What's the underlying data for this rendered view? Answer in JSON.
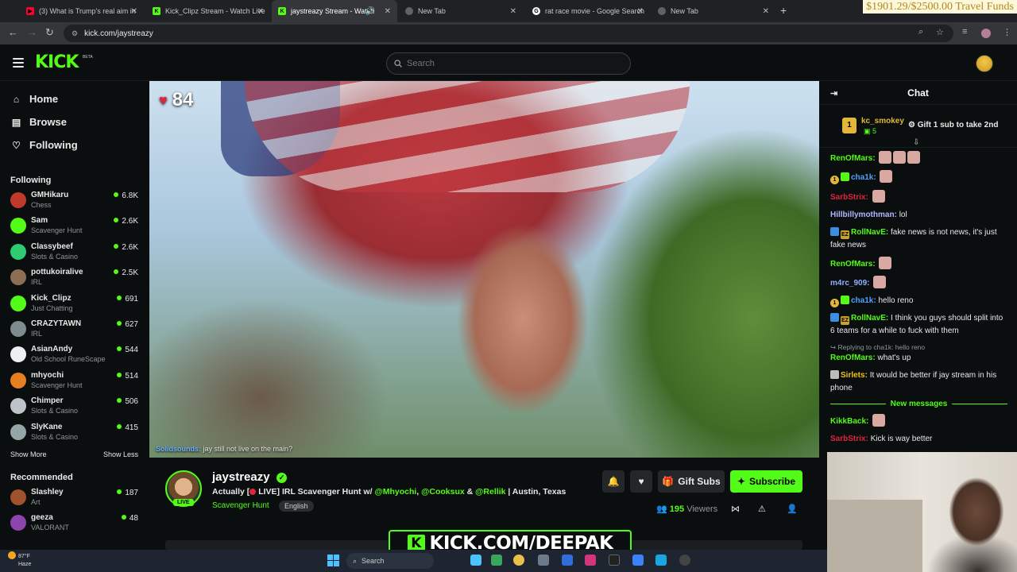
{
  "browser": {
    "tabs": [
      {
        "title": "(3) What is Trump's real aim in",
        "active": false,
        "favicon": "youtube-icon",
        "color": "#ff0033"
      },
      {
        "title": "Kick_Clipz Stream - Watch Live",
        "active": false,
        "favicon": "kick-icon",
        "color": "#53fc18"
      },
      {
        "title": "jaystreazy Stream - Watch",
        "active": true,
        "favicon": "kick-icon",
        "color": "#53fc18"
      },
      {
        "title": "New Tab",
        "active": false,
        "favicon": "globe-icon",
        "color": "#9aa0a6"
      },
      {
        "title": "rat race movie - Google Search",
        "active": false,
        "favicon": "google-icon",
        "color": "#ffffff"
      },
      {
        "title": "New Tab",
        "active": false,
        "favicon": "globe-icon",
        "color": "#9aa0a6"
      }
    ],
    "url": "kick.com/jaystreazy",
    "overlay_text": "$1901.29/$2500.00 Travel Funds"
  },
  "kick": {
    "logo": "KICK",
    "logo_badge": "BETA",
    "search_placeholder": "Search",
    "accent": "#53fc18"
  },
  "sidebar": {
    "nav": [
      {
        "label": "Home",
        "icon": "home-icon"
      },
      {
        "label": "Browse",
        "icon": "browse-icon"
      },
      {
        "label": "Following",
        "icon": "heart-icon"
      }
    ],
    "following_title": "Following",
    "following": [
      {
        "name": "GMHikaru",
        "category": "Chess",
        "viewers": "6.8K",
        "color": "#c0392b"
      },
      {
        "name": "Sam",
        "category": "Scavenger Hunt",
        "viewers": "2.6K",
        "color": "#53fc18"
      },
      {
        "name": "Classybeef",
        "category": "Slots & Casino",
        "viewers": "2.6K",
        "color": "#2ecc71"
      },
      {
        "name": "pottukoiralive",
        "category": "IRL",
        "viewers": "2.5K",
        "color": "#8e6e53"
      },
      {
        "name": "Kick_Clipz",
        "category": "Just Chatting",
        "viewers": "691",
        "color": "#53fc18"
      },
      {
        "name": "CRAZYTAWN",
        "category": "IRL",
        "viewers": "627",
        "color": "#7f8c8d"
      },
      {
        "name": "AsianAndy",
        "category": "Old School RuneScape",
        "viewers": "544",
        "color": "#ecf0f1"
      },
      {
        "name": "mhyochi",
        "category": "Scavenger Hunt",
        "viewers": "514",
        "color": "#e67e22"
      },
      {
        "name": "Chimper",
        "category": "Slots & Casino",
        "viewers": "506",
        "color": "#bdc3c7"
      },
      {
        "name": "SlyKane",
        "category": "Slots & Casino",
        "viewers": "415",
        "color": "#95a5a6"
      }
    ],
    "show_more": "Show More",
    "show_less": "Show Less",
    "recommended_title": "Recommended",
    "recommended": [
      {
        "name": "Slashley",
        "category": "Art",
        "viewers": "187",
        "color": "#a0522d"
      },
      {
        "name": "geeza",
        "category": "VALORANT",
        "viewers": "48",
        "color": "#8e44ad"
      }
    ]
  },
  "video": {
    "viewer_count": "84",
    "overlay_user": "Solidsounds:",
    "overlay_msg": "jay still not live on the main?"
  },
  "stream": {
    "streamer": "jaystreazy",
    "live_label": "LIVE",
    "title_prefix": "Actually [",
    "title_live": "LIVE] IRL Scavenger Hunt w/",
    "mention1": "@Mhyochi",
    "comma": ",",
    "mention2": "@Cooksux",
    "amp": "&",
    "mention3": "@Rellik",
    "location": "| Austin, Texas",
    "category": "Scavenger Hunt",
    "language": "English",
    "gift_label": "Gift Subs",
    "subscribe_label": "Subscribe",
    "viewers_num": "195",
    "viewers_label": "Viewers"
  },
  "chat": {
    "title": "Chat",
    "pinned_user": "kc_smokey",
    "pinned_count": "5",
    "pinned_rank": "1",
    "gift_prompt": "Gift 1 sub to take 2nd",
    "messages": [
      {
        "user": "RenOfMars:",
        "color": "#53fc18",
        "text": "",
        "emotes": 3
      },
      {
        "user": "cha1k:",
        "color": "#4aa3ff",
        "text": "",
        "emotes": 1,
        "badges": [
          "1",
          "sub"
        ]
      },
      {
        "user": "SarbStrix:",
        "color": "#e0243d",
        "text": "",
        "emotes": 1
      },
      {
        "user": "Hillbillymothman:",
        "color": "#b0b6ff",
        "text": "lol"
      },
      {
        "user": "RollNavE:",
        "color": "#53fc18",
        "text": "fake news is not news, it's just fake news",
        "badges": [
          "mod",
          "EZ"
        ]
      },
      {
        "user": "RenOfMars:",
        "color": "#53fc18",
        "text": "",
        "emotes": 1
      },
      {
        "user": "m4rc_909:",
        "color": "#8fb0ff",
        "text": "",
        "emotes": 1
      },
      {
        "user": "cha1k:",
        "color": "#4aa3ff",
        "text": "hello reno",
        "badges": [
          "1",
          "sub"
        ]
      },
      {
        "user": "RollNavE:",
        "color": "#53fc18",
        "text": "I think you guys should split into 6 teams for a while to fuck with them",
        "badges": [
          "mod",
          "EZ"
        ]
      },
      {
        "reply": "Replying to cha1k: hello reno",
        "user": "RenOfMars:",
        "color": "#53fc18",
        "text": "what's up"
      },
      {
        "user": "Sirlets:",
        "color": "#f0c419",
        "text": "It would be better if jay stream in his phone",
        "badges": [
          "gift"
        ]
      }
    ],
    "new_messages": "New messages",
    "after_messages": [
      {
        "user": "KikkBack:",
        "color": "#53fc18",
        "text": "",
        "emotes": 1
      },
      {
        "user": "SarbStrix:",
        "color": "#e0243d",
        "text": "Kick is way better"
      }
    ]
  },
  "banner": {
    "k": "K",
    "text": "KICK.COM/DEEPAK"
  },
  "taskbar": {
    "temp": "87°F",
    "weather": "Haze",
    "search": "Search"
  }
}
